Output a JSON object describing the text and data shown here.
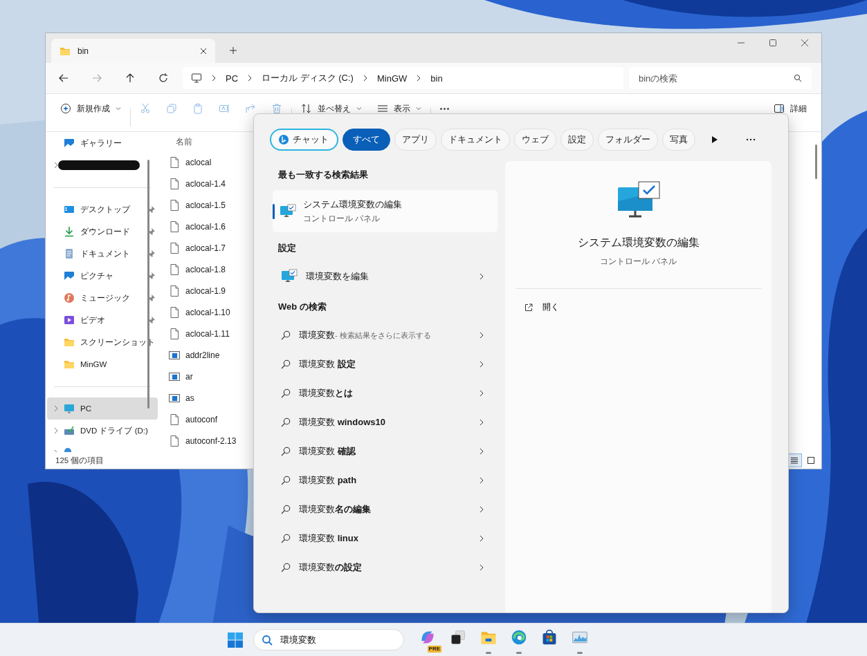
{
  "explorer": {
    "tab": {
      "title": "bin"
    },
    "nav": [
      {
        "kind": "back",
        "disabled": false
      },
      {
        "kind": "forward",
        "disabled": true
      },
      {
        "kind": "up",
        "disabled": false
      },
      {
        "kind": "refresh",
        "disabled": false
      }
    ],
    "address": [
      "PC",
      "ローカル ディスク (C:)",
      "MinGW",
      "bin"
    ],
    "search": {
      "placeholder": "binの検索"
    },
    "toolbar": [
      {
        "kind": "new",
        "label": "新規作成",
        "disabled": false
      },
      {
        "kind": "cut",
        "disabled": true
      },
      {
        "kind": "copy",
        "disabled": true
      },
      {
        "kind": "paste",
        "disabled": true
      },
      {
        "kind": "rename",
        "disabled": true
      },
      {
        "kind": "share",
        "disabled": true
      },
      {
        "kind": "delete",
        "disabled": true
      },
      {
        "kind": "sort",
        "label": "並べ替え",
        "disabled": false
      },
      {
        "kind": "view",
        "label": "表示",
        "disabled": false
      },
      {
        "kind": "more",
        "disabled": false
      }
    ],
    "details_button": "詳細",
    "sidebar": [
      {
        "kind": "gallery",
        "label": "ギャラリー",
        "selected": false,
        "pinned": false,
        "expandable": false
      },
      {
        "kind": "redacted",
        "selected": false,
        "pinned": false,
        "expandable": true
      },
      {
        "kind": "divider"
      },
      {
        "kind": "desktop",
        "label": "デスクトップ",
        "selected": false,
        "pinned": true,
        "expandable": false
      },
      {
        "kind": "download",
        "label": "ダウンロード",
        "selected": false,
        "pinned": true,
        "expandable": false
      },
      {
        "kind": "document",
        "label": "ドキュメント",
        "selected": false,
        "pinned": true,
        "expandable": false
      },
      {
        "kind": "picture",
        "label": "ピクチャ",
        "selected": false,
        "pinned": true,
        "expandable": false
      },
      {
        "kind": "music",
        "label": "ミュージック",
        "selected": false,
        "pinned": true,
        "expandable": false
      },
      {
        "kind": "video",
        "label": "ビデオ",
        "selected": false,
        "pinned": true,
        "expandable": false
      },
      {
        "kind": "folder",
        "label": "スクリーンショット",
        "selected": false,
        "pinned": false,
        "expandable": false
      },
      {
        "kind": "folder",
        "label": "MinGW",
        "selected": false,
        "pinned": false,
        "expandable": false
      },
      {
        "kind": "divider"
      },
      {
        "kind": "pc",
        "label": "PC",
        "selected": true,
        "pinned": false,
        "expandable": true
      },
      {
        "kind": "dvd",
        "label": "DVD ドライブ (D:)",
        "selected": false,
        "pinned": false,
        "expandable": true
      },
      {
        "kind": "network",
        "selected": false,
        "pinned": false,
        "expandable": true
      }
    ],
    "column_header": "名前",
    "files": [
      {
        "name": "aclocal",
        "kind": "file"
      },
      {
        "name": "aclocal-1.4",
        "kind": "file"
      },
      {
        "name": "aclocal-1.5",
        "kind": "file"
      },
      {
        "name": "aclocal-1.6",
        "kind": "file"
      },
      {
        "name": "aclocal-1.7",
        "kind": "file"
      },
      {
        "name": "aclocal-1.8",
        "kind": "file"
      },
      {
        "name": "aclocal-1.9",
        "kind": "file"
      },
      {
        "name": "aclocal-1.10",
        "kind": "file"
      },
      {
        "name": "aclocal-1.11",
        "kind": "file"
      },
      {
        "name": "addr2line",
        "kind": "exe"
      },
      {
        "name": "ar",
        "kind": "exe"
      },
      {
        "name": "as",
        "kind": "exe"
      },
      {
        "name": "autoconf",
        "kind": "file"
      },
      {
        "name": "autoconf-2.13",
        "kind": "file"
      }
    ],
    "status": "125 個の項目",
    "view_modes": [
      {
        "kind": "details",
        "selected": true
      },
      {
        "kind": "tiles",
        "selected": false
      }
    ]
  },
  "search_panel": {
    "chips": [
      {
        "kind": "chat",
        "label": "チャット",
        "selected": false
      },
      {
        "kind": "text",
        "label": "すべて",
        "selected": true
      },
      {
        "kind": "text",
        "label": "アプリ",
        "selected": false
      },
      {
        "kind": "text",
        "label": "ドキュメント",
        "selected": false
      },
      {
        "kind": "text",
        "label": "ウェブ",
        "selected": false
      },
      {
        "kind": "text",
        "label": "設定",
        "selected": false
      },
      {
        "kind": "text",
        "label": "フォルダー",
        "selected": false
      },
      {
        "kind": "text",
        "label": "写真",
        "selected": false
      }
    ],
    "best_match_heading": "最も一致する検索結果",
    "best_match": {
      "title": "システム環境変数の編集",
      "subtitle": "コントロール パネル",
      "selected": true
    },
    "settings_heading": "設定",
    "settings": [
      {
        "label": "環境変数を編集"
      }
    ],
    "web_heading": "Web の検索",
    "web_results": [
      {
        "text": "環境変数",
        "hint": "- 検索結果をさらに表示する"
      },
      {
        "text": "環境変数 **設定**"
      },
      {
        "text": "環境変数**とは**"
      },
      {
        "text": "環境変数 **windows10**"
      },
      {
        "text": "環境変数 **確認**"
      },
      {
        "text": "環境変数 **path**"
      },
      {
        "text": "環境変数**名の編集**"
      },
      {
        "text": "環境変数 **linux**"
      },
      {
        "text": "環境変数**の設定**"
      }
    ],
    "preview": {
      "title": "システム環境変数の編集",
      "subtitle": "コントロール パネル",
      "action": "開く"
    }
  },
  "taskbar": {
    "search": {
      "value": "環境変数"
    },
    "apps": [
      {
        "kind": "copilot",
        "badge": "PRE",
        "running": false
      },
      {
        "kind": "taskview",
        "running": false
      },
      {
        "kind": "explorer",
        "running": true
      },
      {
        "kind": "edge",
        "running": true
      },
      {
        "kind": "store",
        "running": false
      },
      {
        "kind": "monitor",
        "running": true
      }
    ]
  }
}
